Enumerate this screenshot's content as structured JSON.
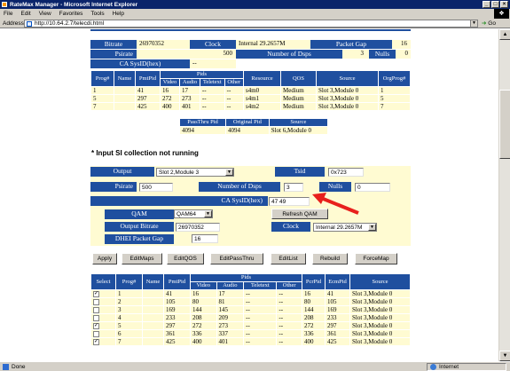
{
  "window": {
    "title": "RateMax Manager - Microsoft Internet Explorer",
    "min": "_",
    "max": "□",
    "close": "×"
  },
  "menu": [
    "File",
    "Edit",
    "View",
    "Favorites",
    "Tools",
    "Help"
  ],
  "address": {
    "label": "Address",
    "url": "http://10.64.2.7/telecdi.html",
    "go": "Go"
  },
  "status": {
    "left": "Done",
    "zone": "Internet"
  },
  "top_summary": {
    "bitrate_label": "Bitrate",
    "bitrate_value": "26970352",
    "clock_label": "Clock",
    "clock_value": "Internal 29.2657M",
    "packetgap_label": "Packet Gap",
    "packetgap_value": "16",
    "psirate_label": "Psirate",
    "psirate_value": "500",
    "numdsps_label": "Number of Dsps",
    "numdsps_value": "3",
    "nulls_label": "Nulls",
    "nulls_value": "0",
    "casysid_label": "CA SysID(hex)",
    "casysid_value": "--"
  },
  "top_table": {
    "headers": [
      "Prog#",
      "Name",
      "PmtPid",
      "Video",
      "Audio",
      "Teletext",
      "Other",
      "Resource",
      "QOS",
      "Source",
      "OrgProg#"
    ],
    "pids_label": "Pids",
    "rows": [
      [
        "1",
        "",
        "41",
        "16",
        "17",
        "--",
        "--",
        "s4m0",
        "Medium",
        "Slot 3,Module 0",
        "1"
      ],
      [
        "5",
        "",
        "297",
        "272",
        "273",
        "--",
        "--",
        "s4m1",
        "Medium",
        "Slot 3,Module 0",
        "5"
      ],
      [
        "7",
        "",
        "425",
        "400",
        "401",
        "--",
        "--",
        "s4m2",
        "Medium",
        "Slot 3,Module 0",
        "7"
      ]
    ]
  },
  "passthru": {
    "headers": [
      "PassThru Pid",
      "Original Pid",
      "Source"
    ],
    "row": [
      "4094",
      "4094",
      "Slot 6,Module 0"
    ]
  },
  "notice": "* Input SI collection not running",
  "form": {
    "output_label": "Output",
    "output_value": "Slot 2,Module 3",
    "tsid_label": "Tsid",
    "tsid_value": "0x723",
    "psirate_label": "Psirate",
    "psirate_value": "500",
    "numdsps_label": "Number of Dsps",
    "numdsps_value": "3",
    "nulls_label": "Nulls",
    "nulls_value": "0",
    "casysid_label": "CA SysID(hex)",
    "casysid_value": "47 49",
    "qam_label": "QAM",
    "qam_value": "QAM64",
    "refresh_qam": "Refresh QAM",
    "outbitrate_label": "Output Bitrate",
    "outbitrate_value": "26970352",
    "clock_label": "Clock",
    "clock_value": "Internal 29.2657M",
    "dhei_label": "DHEI Packet Gap",
    "dhei_value": "16"
  },
  "buttons": [
    "Apply",
    "EditMaps",
    "EditQOS",
    "EditPassThru",
    "EditList",
    "Rebuild",
    "ForceMap"
  ],
  "bottom_table": {
    "headers": [
      "Select",
      "Prog#",
      "Name",
      "PmtPid",
      "Video",
      "Audio",
      "Teletext",
      "Other",
      "PcrPid",
      "EcmPid",
      "Source"
    ],
    "pids_label": "Pids",
    "rows": [
      {
        "checked": true,
        "cells": [
          "1",
          "",
          "41",
          "16",
          "17",
          "--",
          "--",
          "16",
          "41",
          "Slot 3,Module 0"
        ]
      },
      {
        "checked": false,
        "cells": [
          "2",
          "",
          "105",
          "80",
          "81",
          "--",
          "--",
          "80",
          "105",
          "Slot 3,Module 0"
        ]
      },
      {
        "checked": false,
        "cells": [
          "3",
          "",
          "169",
          "144",
          "145",
          "--",
          "--",
          "144",
          "169",
          "Slot 3,Module 0"
        ]
      },
      {
        "checked": false,
        "cells": [
          "4",
          "",
          "233",
          "208",
          "209",
          "--",
          "--",
          "208",
          "233",
          "Slot 3,Module 0"
        ]
      },
      {
        "checked": true,
        "cells": [
          "5",
          "",
          "297",
          "272",
          "273",
          "--",
          "--",
          "272",
          "297",
          "Slot 3,Module 0"
        ]
      },
      {
        "checked": false,
        "cells": [
          "6",
          "",
          "361",
          "336",
          "337",
          "--",
          "--",
          "336",
          "361",
          "Slot 3,Module 0"
        ]
      },
      {
        "checked": true,
        "cells": [
          "7",
          "",
          "425",
          "400",
          "401",
          "--",
          "--",
          "400",
          "425",
          "Slot 3,Module 0"
        ]
      }
    ]
  },
  "annotation": {
    "arrow_color": "#e8201c"
  }
}
